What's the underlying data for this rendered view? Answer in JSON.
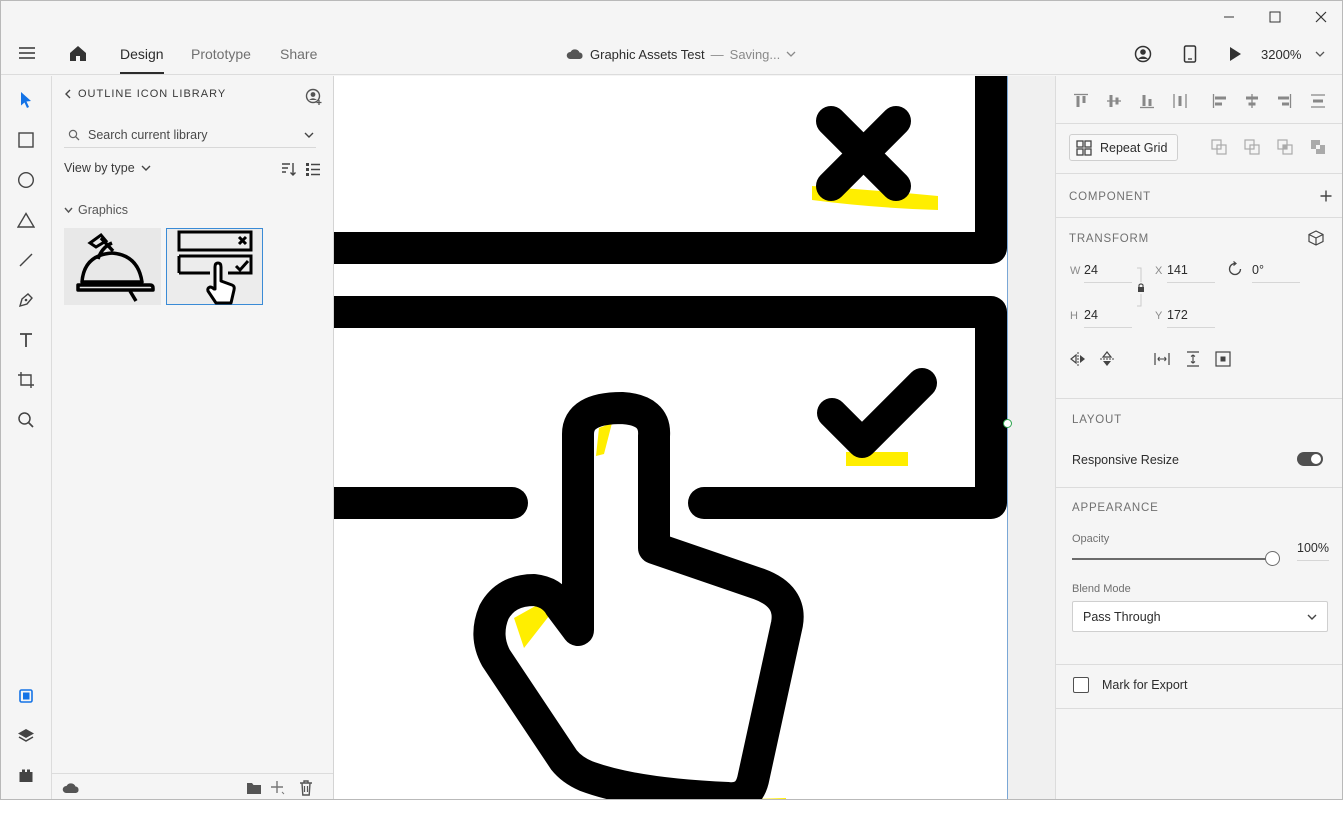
{
  "header": {
    "tabs": [
      {
        "label": "Design"
      },
      {
        "label": "Prototype"
      },
      {
        "label": "Share"
      }
    ],
    "doc_title": "Graphic Assets Test",
    "separator": "—",
    "status": "Saving...",
    "zoom": "3200%"
  },
  "library": {
    "title": "OUTLINE ICON LIBRARY",
    "search_placeholder": "Search current library",
    "view_by": "View by type",
    "group": "Graphics"
  },
  "inspector": {
    "repeat_grid": "Repeat Grid",
    "component": "COMPONENT",
    "transform": "TRANSFORM",
    "w_label": "W",
    "w": "24",
    "x_label": "X",
    "x": "141",
    "rotation": "0°",
    "h_label": "H",
    "h": "24",
    "y_label": "Y",
    "y": "172",
    "layout": "LAYOUT",
    "responsive_resize": "Responsive Resize",
    "responsive_resize_on": true,
    "appearance": "APPEARANCE",
    "opacity_label": "Opacity",
    "opacity": "100%",
    "opacity_value": 1.0,
    "blend_label": "Blend Mode",
    "blend_mode": "Pass Through",
    "mark_for_export": "Mark for Export"
  },
  "colors": {
    "accent": "#1473e6",
    "highlight": "#ffee00",
    "selection": "#3a8bd6"
  }
}
